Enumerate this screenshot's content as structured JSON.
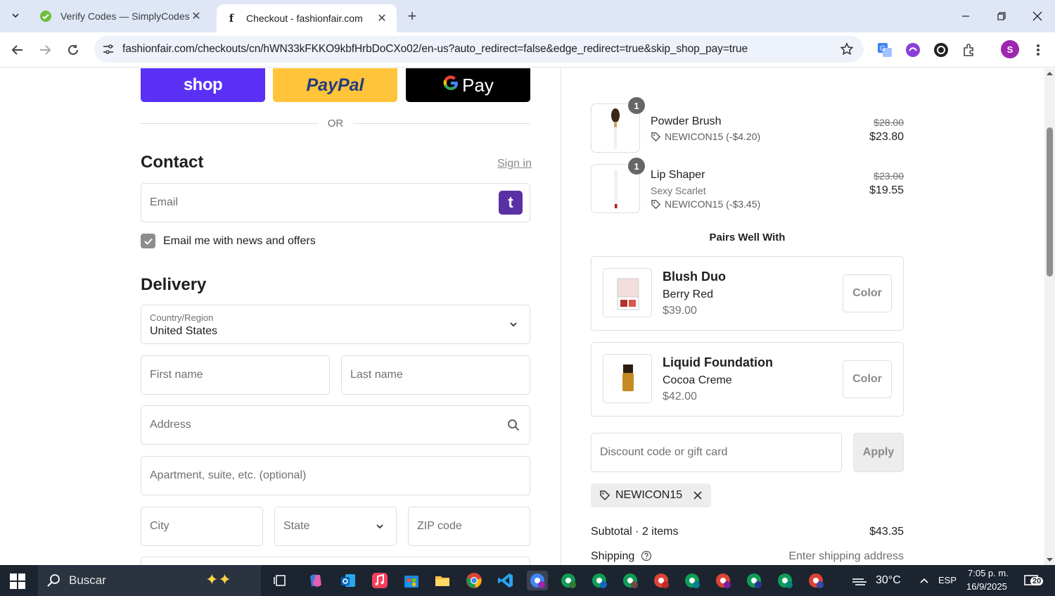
{
  "browser": {
    "tabs": [
      {
        "title": "Verify Codes — SimplyCodes",
        "active": false
      },
      {
        "title": "Checkout - fashionfair.com",
        "active": true
      }
    ],
    "url": "fashionfair.com/checkouts/cn/hWN33kFKKO9kbfHrbDoCXo02/en-us?auto_redirect=false&edge_redirect=true&skip_shop_pay=true",
    "profile_initial": "S"
  },
  "express": {
    "shop": "shop",
    "paypal": "PayPal",
    "gpay": "Pay",
    "or": "OR"
  },
  "contact": {
    "heading": "Contact",
    "sign_in": "Sign in",
    "email_placeholder": "Email",
    "badge": "t",
    "newsletter_label": "Email me with news and offers",
    "newsletter_checked": true
  },
  "delivery": {
    "heading": "Delivery",
    "country_label": "Country/Region",
    "country_value": "United States",
    "first_name": "First name",
    "last_name": "Last name",
    "address": "Address",
    "apartment": "Apartment, suite, etc. (optional)",
    "city": "City",
    "state": "State",
    "zip": "ZIP code"
  },
  "cart": {
    "items": [
      {
        "qty": "1",
        "name": "Powder Brush",
        "variant": "",
        "discount": "NEWICON15 (-$4.20)",
        "old_price": "$28.00",
        "price": "$23.80"
      },
      {
        "qty": "1",
        "name": "Lip Shaper",
        "variant": "Sexy Scarlet",
        "discount": "NEWICON15 (-$3.45)",
        "old_price": "$23.00",
        "price": "$19.55"
      }
    ],
    "pairs_title": "Pairs Well With",
    "upsells": [
      {
        "name": "Blush Duo",
        "variant": "Berry Red",
        "price": "$39.00",
        "button": "Color"
      },
      {
        "name": "Liquid Foundation",
        "variant": "Cocoa Creme",
        "price": "$42.00",
        "button": "Color"
      }
    ],
    "discount_placeholder": "Discount code or gift card",
    "apply": "Apply",
    "applied_code": "NEWICON15",
    "subtotal_label": "Subtotal · 2 items",
    "subtotal_value": "$43.35",
    "shipping_label": "Shipping",
    "shipping_value": "Enter shipping address"
  },
  "taskbar": {
    "search": "Buscar",
    "temp": "30°C",
    "lang": "ESP",
    "time": "7:05 p. m.",
    "date": "16/9/2025",
    "notif_count": "20"
  }
}
